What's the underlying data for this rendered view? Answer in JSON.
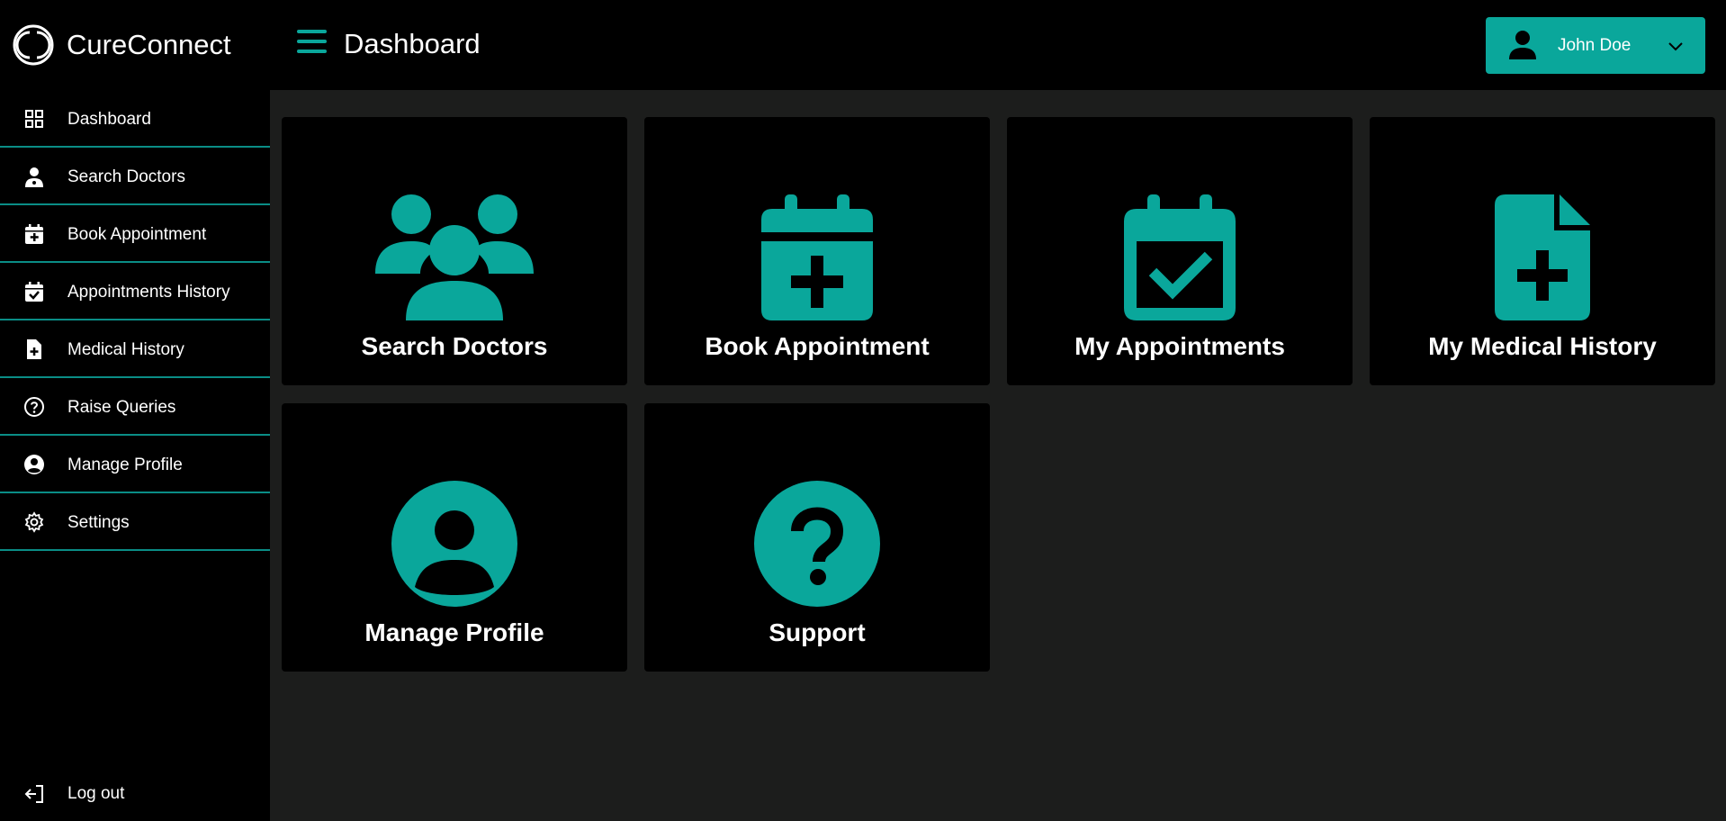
{
  "app": {
    "name": "CureConnect"
  },
  "header": {
    "title": "Dashboard",
    "user_name": "John Doe"
  },
  "sidebar": {
    "items": [
      {
        "label": "Dashboard",
        "icon": "grid-icon"
      },
      {
        "label": "Search Doctors",
        "icon": "doctor-icon"
      },
      {
        "label": "Book Appointment",
        "icon": "calendar-plus-icon"
      },
      {
        "label": "Appointments History",
        "icon": "calendar-check-icon"
      },
      {
        "label": "Medical History",
        "icon": "file-medical-icon"
      },
      {
        "label": "Raise Queries",
        "icon": "question-circle-icon"
      },
      {
        "label": "Manage Profile",
        "icon": "user-circle-icon"
      },
      {
        "label": "Settings",
        "icon": "gear-icon"
      }
    ],
    "logout_label": "Log out"
  },
  "cards": [
    {
      "label": "Search Doctors",
      "icon": "users-icon"
    },
    {
      "label": "Book Appointment",
      "icon": "calendar-plus-icon"
    },
    {
      "label": "My Appointments",
      "icon": "calendar-check-icon"
    },
    {
      "label": "My Medical History",
      "icon": "file-medical-icon"
    },
    {
      "label": "Manage Profile",
      "icon": "user-circle-icon"
    },
    {
      "label": "Support",
      "icon": "question-circle-icon"
    }
  ],
  "colors": {
    "accent": "#0aa79b",
    "background": "#000000",
    "main_background": "#1c1d1c",
    "divider": "#0a8d86"
  }
}
